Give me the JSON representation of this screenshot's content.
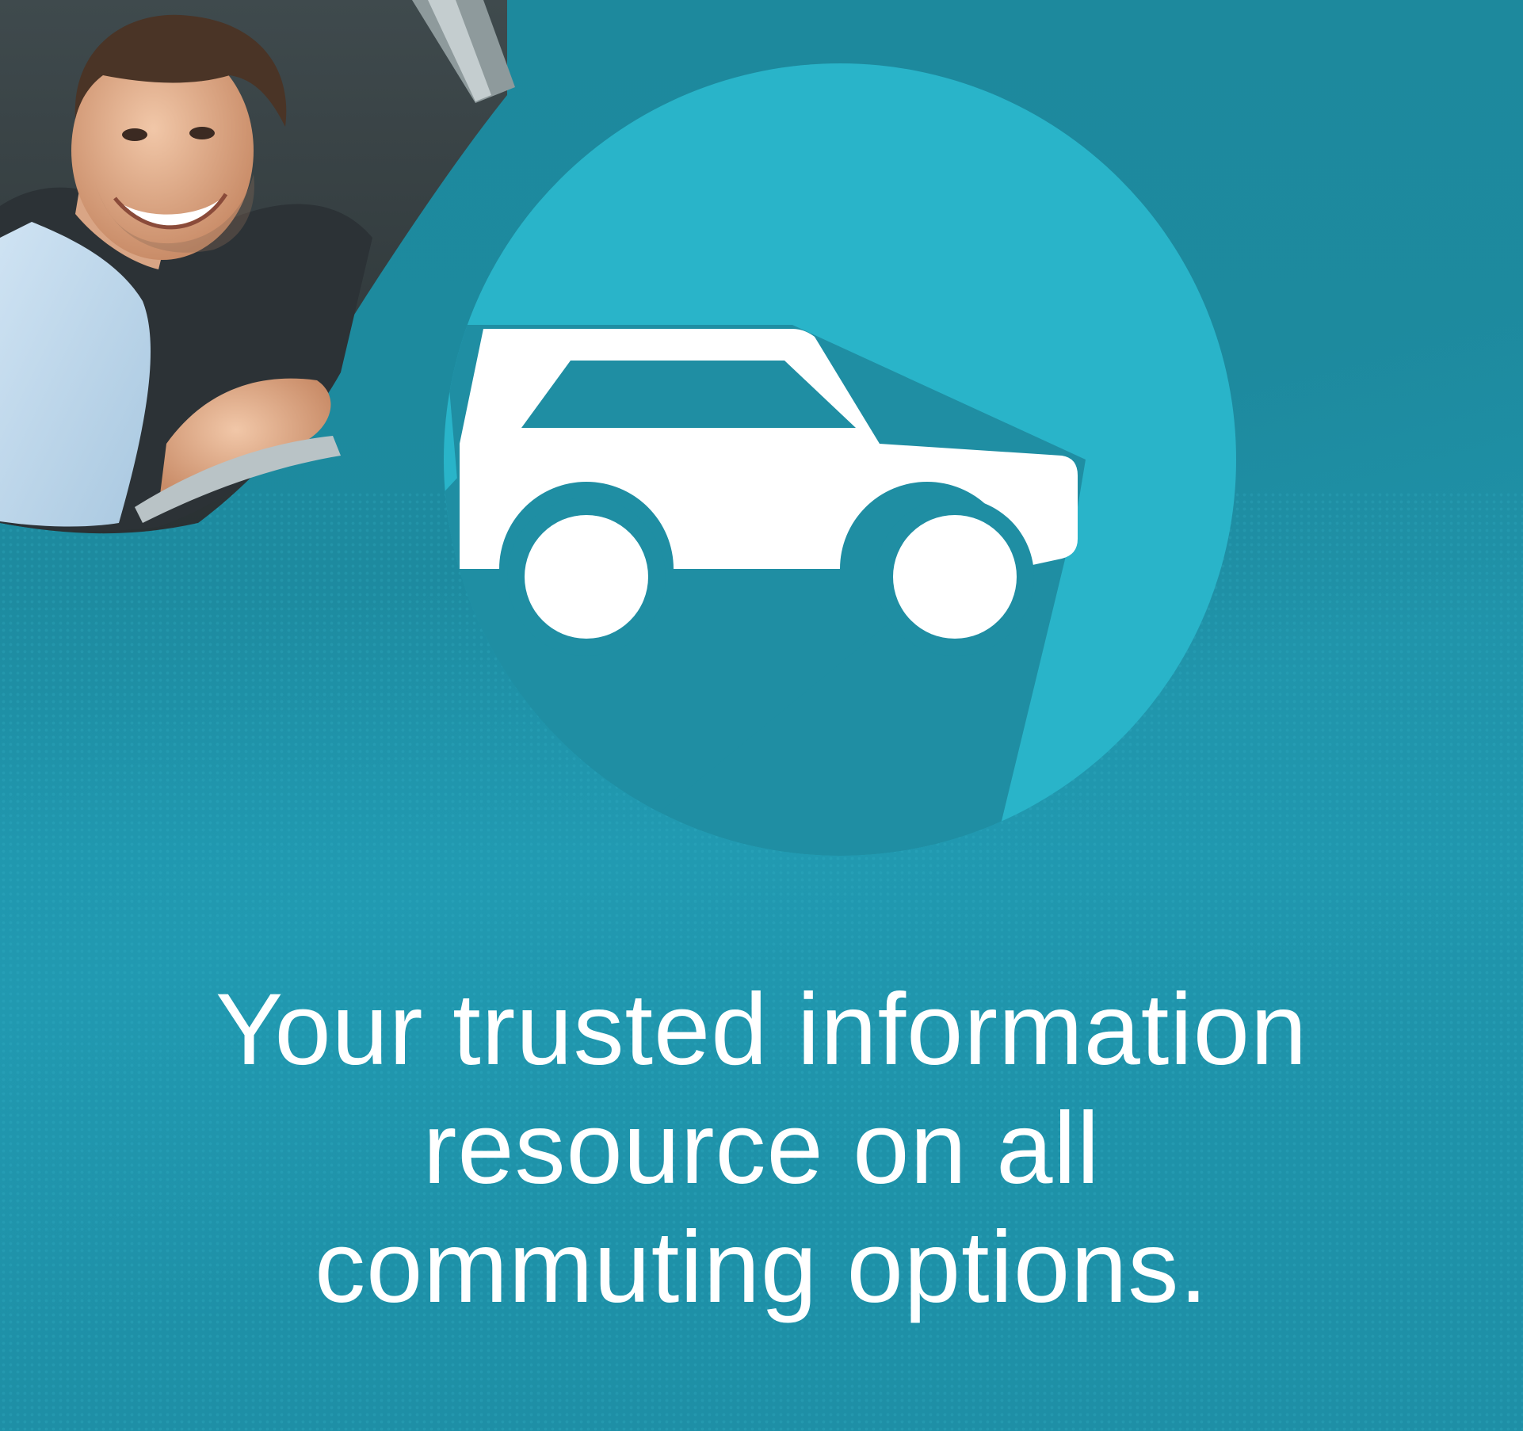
{
  "tagline": {
    "line1": "Your trusted information",
    "line2": "resource on all",
    "line3": "commuting options."
  },
  "colors": {
    "background": "#1f8aa0",
    "circle": "#29b4c9",
    "shadow": "#1f8ea3",
    "icon": "#ffffff",
    "text": "#ffffff"
  },
  "icons": {
    "main": "car-icon"
  }
}
